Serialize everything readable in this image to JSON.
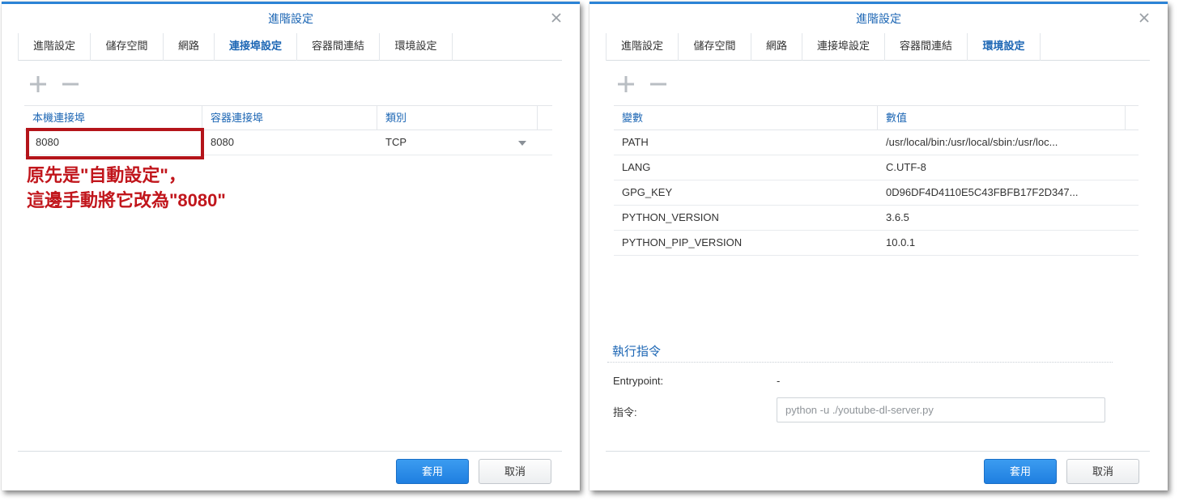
{
  "left": {
    "title": "進階設定",
    "tabs": [
      {
        "label": "進階設定"
      },
      {
        "label": "儲存空間"
      },
      {
        "label": "網路"
      },
      {
        "label": "連接埠設定"
      },
      {
        "label": "容器間連結"
      },
      {
        "label": "環境設定"
      }
    ],
    "active_tab": "連接埠設定",
    "toolbar": {
      "add_icon": "plus-icon",
      "remove_icon": "minus-icon"
    },
    "table": {
      "columns": [
        "本機連接埠",
        "容器連接埠",
        "類別"
      ],
      "rows": [
        {
          "local_port": "8080",
          "container_port": "8080",
          "type": "TCP"
        }
      ]
    },
    "annotation": {
      "line1": "原先是\"自動設定\"，",
      "line2": "這邊手動將它改為\"8080\""
    },
    "footer": {
      "apply_label": "套用",
      "cancel_label": "取消"
    }
  },
  "right": {
    "title": "進階設定",
    "tabs": [
      {
        "label": "進階設定"
      },
      {
        "label": "儲存空間"
      },
      {
        "label": "網路"
      },
      {
        "label": "連接埠設定"
      },
      {
        "label": "容器間連結"
      },
      {
        "label": "環境設定"
      }
    ],
    "active_tab": "環境設定",
    "toolbar": {
      "add_icon": "plus-icon",
      "remove_icon": "minus-icon"
    },
    "table": {
      "columns": [
        "變數",
        "數值"
      ],
      "rows": [
        {
          "name": "PATH",
          "value": "/usr/local/bin:/usr/local/sbin:/usr/loc..."
        },
        {
          "name": "LANG",
          "value": "C.UTF-8"
        },
        {
          "name": "GPG_KEY",
          "value": "0D96DF4D4110E5C43FBFB17F2D347..."
        },
        {
          "name": "PYTHON_VERSION",
          "value": "3.6.5"
        },
        {
          "name": "PYTHON_PIP_VERSION",
          "value": "10.0.1"
        }
      ]
    },
    "exec": {
      "section_title": "執行指令",
      "entrypoint_label": "Entrypoint:",
      "entrypoint_value": "-",
      "command_label": "指令:",
      "command_placeholder": "python -u ./youtube-dl-server.py"
    },
    "footer": {
      "apply_label": "套用",
      "cancel_label": "取消"
    }
  },
  "colors": {
    "accent": "#1c66b4",
    "primary_button": "#2588e6",
    "annotation_red": "#c1161c",
    "header_border": "#2b83d6"
  }
}
